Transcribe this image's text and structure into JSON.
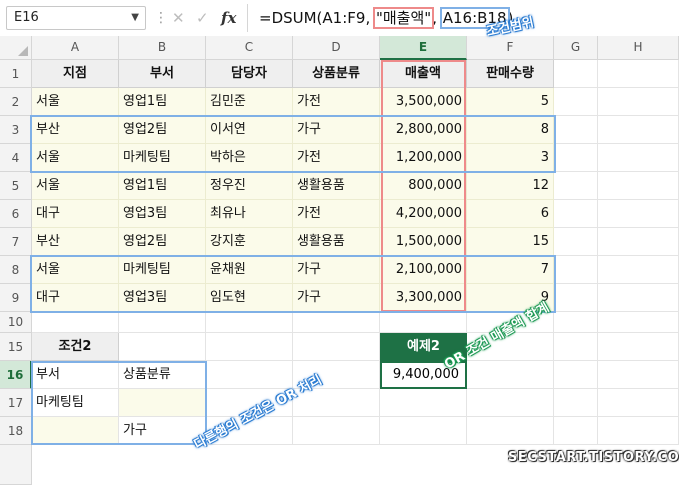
{
  "formula_bar": {
    "name_box": "E16",
    "formula_prefix": "=DSUM(A1:F9, ",
    "formula_field": "\"매출액\"",
    "formula_sep": ", ",
    "formula_criteria": "A16:B18",
    "formula_suffix": ")",
    "cancel_icon": "x-icon",
    "enter_icon": "check-icon",
    "fx_label": "fx"
  },
  "columns": [
    "A",
    "B",
    "C",
    "D",
    "E",
    "F",
    "G",
    "H"
  ],
  "selected_column": "E",
  "rows": [
    "1",
    "2",
    "3",
    "4",
    "5",
    "6",
    "7",
    "8",
    "9",
    "10",
    "15",
    "16",
    "17",
    "18"
  ],
  "selected_row": "16",
  "table": {
    "headers": [
      "지점",
      "부서",
      "담당자",
      "상품분류",
      "매출액",
      "판매수량"
    ],
    "rows": [
      [
        "서울",
        "영업1팀",
        "김민준",
        "가전",
        "3,500,000",
        "5"
      ],
      [
        "부산",
        "영업2팀",
        "이서연",
        "가구",
        "2,800,000",
        "8"
      ],
      [
        "서울",
        "마케팅팀",
        "박하은",
        "가전",
        "1,200,000",
        "3"
      ],
      [
        "서울",
        "영업1팀",
        "정우진",
        "생활용품",
        "800,000",
        "12"
      ],
      [
        "대구",
        "영업3팀",
        "최유나",
        "가전",
        "4,200,000",
        "6"
      ],
      [
        "부산",
        "영업2팀",
        "강지훈",
        "생활용품",
        "1,500,000",
        "15"
      ],
      [
        "서울",
        "마케팅팀",
        "윤채원",
        "가구",
        "2,100,000",
        "7"
      ],
      [
        "대구",
        "영업3팀",
        "임도현",
        "가구",
        "3,300,000",
        "9"
      ]
    ]
  },
  "criteria": {
    "title": "조건2",
    "rows": [
      [
        "부서",
        "상품분류"
      ],
      [
        "마케팅팀",
        ""
      ],
      [
        "",
        "가구"
      ]
    ]
  },
  "example": {
    "title": "예제2",
    "value": "9,400,000"
  },
  "annotations": {
    "criteria_range": "조건범위",
    "sum_note": "OR 조건 매출액 합계",
    "or_note": "다른행의 조건은 OR 처리"
  },
  "watermark": "SECSTART.TISTORY.COM",
  "colors": {
    "excel_green": "#1e7145",
    "highlight_blue": "#7fb0e6",
    "highlight_red": "#ee8a8a",
    "data_fill": "#fbfbea"
  }
}
